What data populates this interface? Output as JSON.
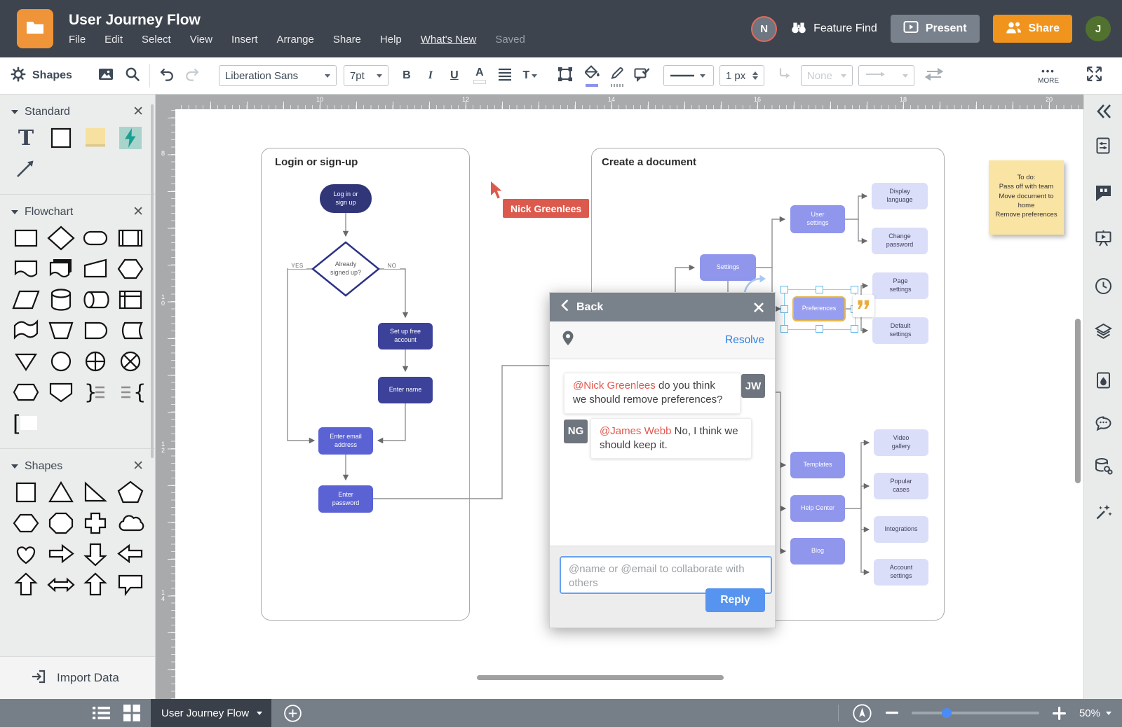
{
  "header": {
    "title": "User Journey Flow",
    "menus": [
      {
        "label": "File"
      },
      {
        "label": "Edit"
      },
      {
        "label": "Select"
      },
      {
        "label": "View"
      },
      {
        "label": "Insert"
      },
      {
        "label": "Arrange"
      },
      {
        "label": "Share"
      },
      {
        "label": "Help"
      },
      {
        "label": "What's New",
        "underline": true
      },
      {
        "label": "Saved",
        "muted": true
      }
    ],
    "collaborator_initial": "N",
    "feature_find": "Feature Find",
    "present": "Present",
    "share": "Share",
    "user_initial": "J",
    "icons": [
      "folder-icon",
      "binoculars-icon",
      "play-present-icon",
      "people-share-icon"
    ]
  },
  "toolbar": {
    "shapes_label": "Shapes",
    "font": "Liberation Sans",
    "font_size": "7pt",
    "bold": "B",
    "italic": "I",
    "underline": "U",
    "font_color": "A",
    "text_style": "T",
    "stroke_width": "1 px",
    "line_end": "None",
    "more": "MORE",
    "icons": [
      "gear-icon",
      "image-icon",
      "search-icon",
      "undo-icon",
      "redo-icon",
      "frame-icon",
      "fill-bucket-icon",
      "pencil-icon",
      "comment-check-icon",
      "line-style-icon",
      "elbow-connector-icon",
      "arrow-end-icon",
      "swap-arrows-icon",
      "fullscreen-icon"
    ]
  },
  "left_panel": {
    "sections": [
      {
        "title": "Standard",
        "shapes": [
          "text-t",
          "rectangle",
          "sticky-note",
          "lightning-tile",
          "line-arrow"
        ]
      },
      {
        "title": "Flowchart",
        "shapes": [
          "process",
          "decision",
          "terminator",
          "predefined-process",
          "document",
          "multi-document",
          "manual-input",
          "preparation",
          "parallelogram",
          "database",
          "direct-data",
          "internal-storage",
          "paper-tape",
          "manual-operation",
          "delay",
          "stored-data",
          "merge",
          "connector",
          "summing-junction",
          "or-junction",
          "display",
          "off-page-connector",
          "brace-right",
          "brace-left",
          "note-bracket"
        ]
      },
      {
        "title": "Shapes",
        "shapes": [
          "square",
          "triangle",
          "right-triangle",
          "pentagon",
          "hexagon",
          "octagon",
          "cross",
          "cloud",
          "heart",
          "arrow-right",
          "arrow-down",
          "arrow-left",
          "arrow-up",
          "arrow-double",
          "arrow-up-alt",
          "callout"
        ]
      }
    ],
    "import_data": "Import Data"
  },
  "canvas": {
    "rulers": {
      "top": [
        "10",
        "12",
        "14",
        "16",
        "18",
        "20"
      ],
      "left": [
        "8",
        "10",
        "12",
        "14"
      ]
    },
    "containers": [
      {
        "title": "Login or sign-up"
      },
      {
        "title": "Create a document"
      }
    ],
    "nodes": {
      "login": {
        "label": "Log in or\nsign up"
      },
      "decision": {
        "label": "Already\nsigned up?"
      },
      "setup": {
        "label": "Set up free\naccount"
      },
      "name": {
        "label": "Enter name"
      },
      "email": {
        "label": "Enter email\naddress"
      },
      "password": {
        "label": "Enter\npassword"
      },
      "settings": {
        "label": "Settings"
      },
      "user_settings": {
        "label": "User\nsettings"
      },
      "display_language": {
        "label": "Display\nlanguage"
      },
      "change_password": {
        "label": "Change\npassword"
      },
      "page_settings": {
        "label": "Page\nsettings"
      },
      "preferences": {
        "label": "Preferences"
      },
      "default_settings": {
        "label": "Default\nsettings"
      },
      "templates": {
        "label": "Templates"
      },
      "help_center": {
        "label": "Help Center"
      },
      "blog": {
        "label": "Blog"
      },
      "video_gallery": {
        "label": "Video\ngallery"
      },
      "popular_cases": {
        "label": "Popular\ncases"
      },
      "integrations": {
        "label": "Integrations"
      },
      "account_settings": {
        "label": "Account\nsettings"
      }
    },
    "edge_labels": {
      "yes": "YES",
      "no": "NO"
    },
    "collaborator_cursor": "Nick Greenlees",
    "sticky_note": "To do:\nPass off with team\nMove document to\nhome\nRemove preferences"
  },
  "comment_popup": {
    "back": "Back",
    "resolve": "Resolve",
    "comments": [
      {
        "initials": "JW",
        "mention": "@Nick Greenlees",
        "text": "do you think we should remove preferences?",
        "avatar_side": "right"
      },
      {
        "initials": "NG",
        "mention": "@James Webb",
        "text": "No, I think we should keep it.",
        "avatar_side": "left"
      }
    ],
    "reply_placeholder": "@name or @email to collaborate with others",
    "reply_button": "Reply",
    "icons": [
      "back-chevron-icon",
      "close-icon",
      "location-pin-icon"
    ]
  },
  "right_sidebar": {
    "icons": [
      "collapse-panel-icon",
      "document-settings-icon",
      "comments-icon",
      "present-mode-icon",
      "history-icon",
      "layers-icon",
      "theme-icon",
      "chat-icon",
      "data-linking-icon",
      "magic-wand-icon"
    ],
    "active_icon": "comments-icon"
  },
  "bottom_bar": {
    "tab_label": "User Journey Flow",
    "zoom_level": "50%",
    "icons": [
      "list-view-icon",
      "grid-view-icon",
      "add-page-icon",
      "pan-mode-icon",
      "zoom-out-icon",
      "zoom-in-icon"
    ]
  },
  "colors": {
    "header_bg": "#3e444d",
    "logo_orange": "#ef9439",
    "share_orange": "#f0941e",
    "present_gray": "#79818c",
    "avatar_green": "#51722f",
    "avatar_ring_red": "#e2695c",
    "node_terminator": "#313679",
    "node_dark": "#3c4299",
    "node_mid": "#5a62d4",
    "node_purple": "#8f96ec",
    "node_light": "#dbdef8",
    "selection_blue": "#5cb8e8",
    "comment_gold": "#e9ab3a",
    "cursor_red": "#dc5a4d",
    "mention_red": "#e2574d",
    "resolve_blue": "#2e7fe0",
    "reply_blue": "#5694ef",
    "sticky_yellow": "#fae4a3",
    "bottom_bar": "#767e88",
    "zoom_knob": "#4a8cf6"
  }
}
